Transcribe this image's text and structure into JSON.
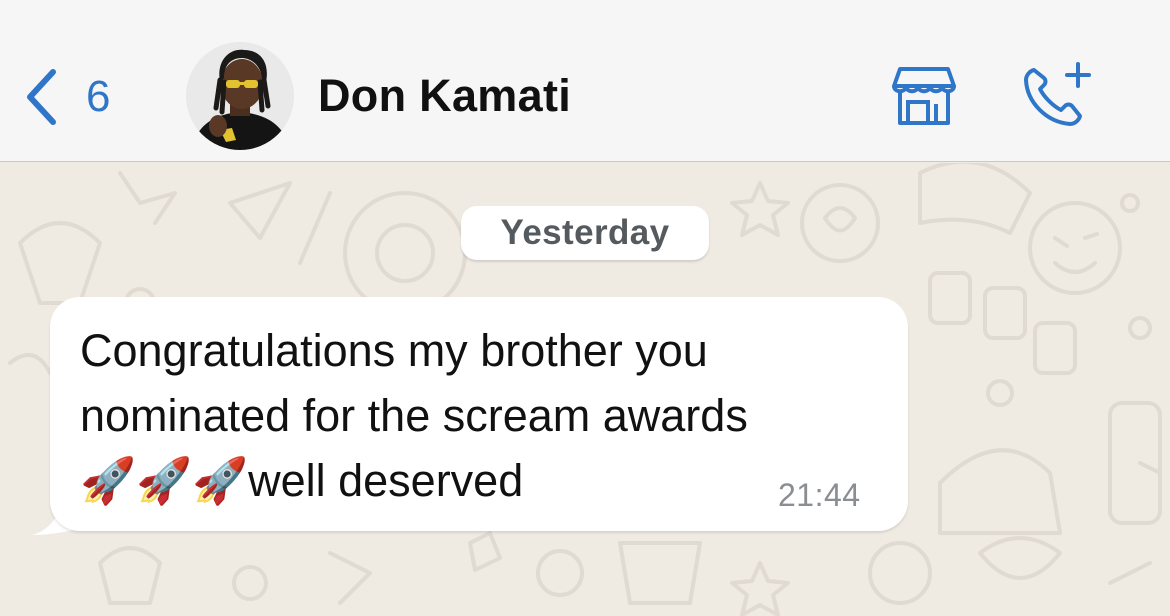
{
  "header": {
    "back_count": "6",
    "contact_name": "Don Kamati",
    "shop_icon": "storefront-icon",
    "call_icon": "add-call-icon"
  },
  "chat": {
    "date_separator": "Yesterday",
    "messages": [
      {
        "direction": "incoming",
        "line1": "Congratulations my brother you",
        "line2": "nominated for the scream awards",
        "line3": "🚀🚀🚀well deserved",
        "time": "21:44"
      }
    ]
  },
  "colors": {
    "accent": "#2f76c9",
    "header_bg": "#f6f6f6",
    "chat_bg": "#efeae2",
    "bubble_bg": "#ffffff",
    "time_text": "#8a8d91"
  }
}
